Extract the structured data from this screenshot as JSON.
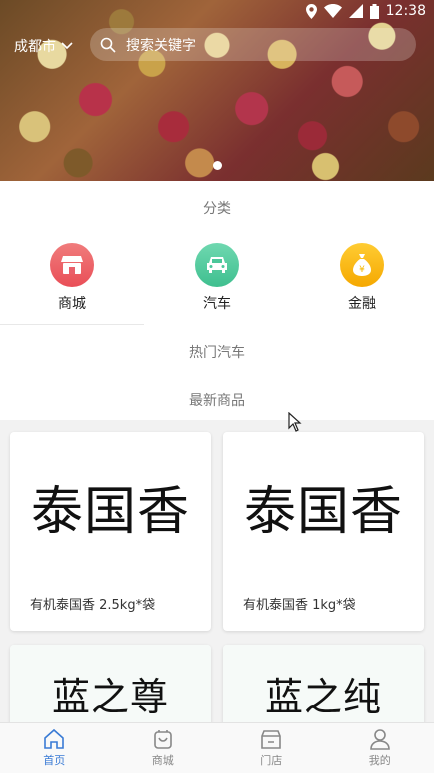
{
  "status_bar": {
    "time": "12:38"
  },
  "header": {
    "city": "成都市",
    "search_placeholder": "搜索关键字"
  },
  "banner": {
    "slide_count": 1,
    "active_slide": 1
  },
  "sections": {
    "category_title": "分类",
    "hot_cars_title": "热门汽车",
    "new_products_title": "最新商品"
  },
  "categories": [
    {
      "label": "商城",
      "icon": "store-icon",
      "color": "#ef5350"
    },
    {
      "label": "汽车",
      "icon": "car-icon",
      "color": "#4cc79a"
    },
    {
      "label": "金融",
      "icon": "money-bag-icon",
      "color": "#f5b800"
    }
  ],
  "products": [
    {
      "image_text": "泰国香",
      "name": "有机泰国香 2.5kg*袋"
    },
    {
      "image_text": "泰国香",
      "name": "有机泰国香 1kg*袋"
    },
    {
      "image_text": "蓝之尊",
      "name": ""
    },
    {
      "image_text": "蓝之纯",
      "name": ""
    }
  ],
  "tabbar": [
    {
      "label": "首页",
      "icon": "home-icon",
      "active": true
    },
    {
      "label": "商城",
      "icon": "shopping-bag-icon",
      "active": false
    },
    {
      "label": "门店",
      "icon": "store-icon",
      "active": false
    },
    {
      "label": "我的",
      "icon": "user-icon",
      "active": false
    }
  ],
  "colors": {
    "accent": "#3a7bd5",
    "tab_inactive": "#888888"
  }
}
